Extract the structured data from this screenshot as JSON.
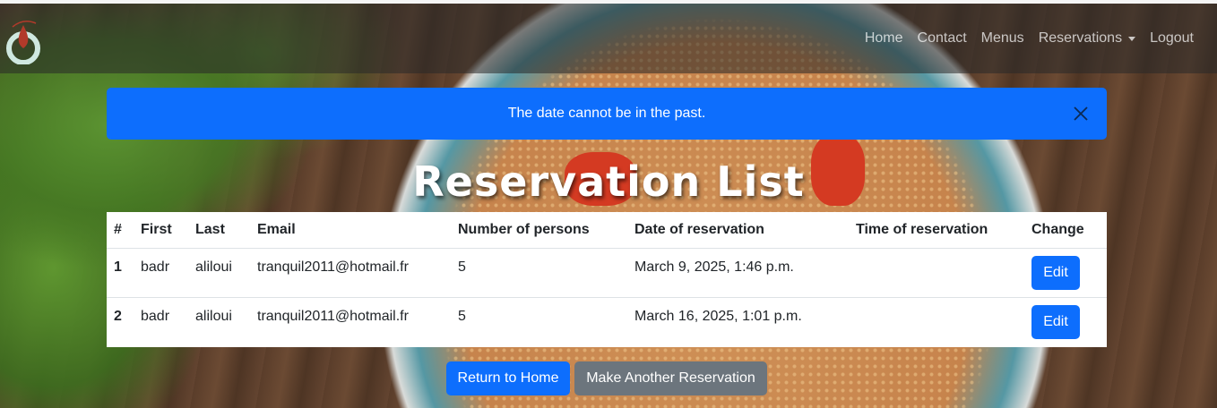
{
  "nav": {
    "links": [
      "Home",
      "Contact",
      "Menus",
      "Reservations",
      "Logout"
    ]
  },
  "alert": {
    "message": "The date cannot be in the past."
  },
  "page": {
    "title": "Reservation List"
  },
  "table": {
    "headers": [
      "#",
      "First",
      "Last",
      "Email",
      "Number of persons",
      "Date of reservation",
      "Time of reservation",
      "Change"
    ],
    "rows": [
      {
        "num": "1",
        "first": "badr",
        "last": "aliloui",
        "email": "tranquil2011@hotmail.fr",
        "persons": "5",
        "date": "March 9, 2025, 1:46 p.m.",
        "time": "",
        "action": "Edit"
      },
      {
        "num": "2",
        "first": "badr",
        "last": "aliloui",
        "email": "tranquil2011@hotmail.fr",
        "persons": "5",
        "date": "March 16, 2025, 1:01 p.m.",
        "time": "",
        "action": "Edit"
      }
    ]
  },
  "actions": {
    "home_label": "Return to Home",
    "again_label": "Make Another Reservation"
  },
  "colors": {
    "primary": "#0d6efd",
    "secondary": "#6c757d"
  }
}
